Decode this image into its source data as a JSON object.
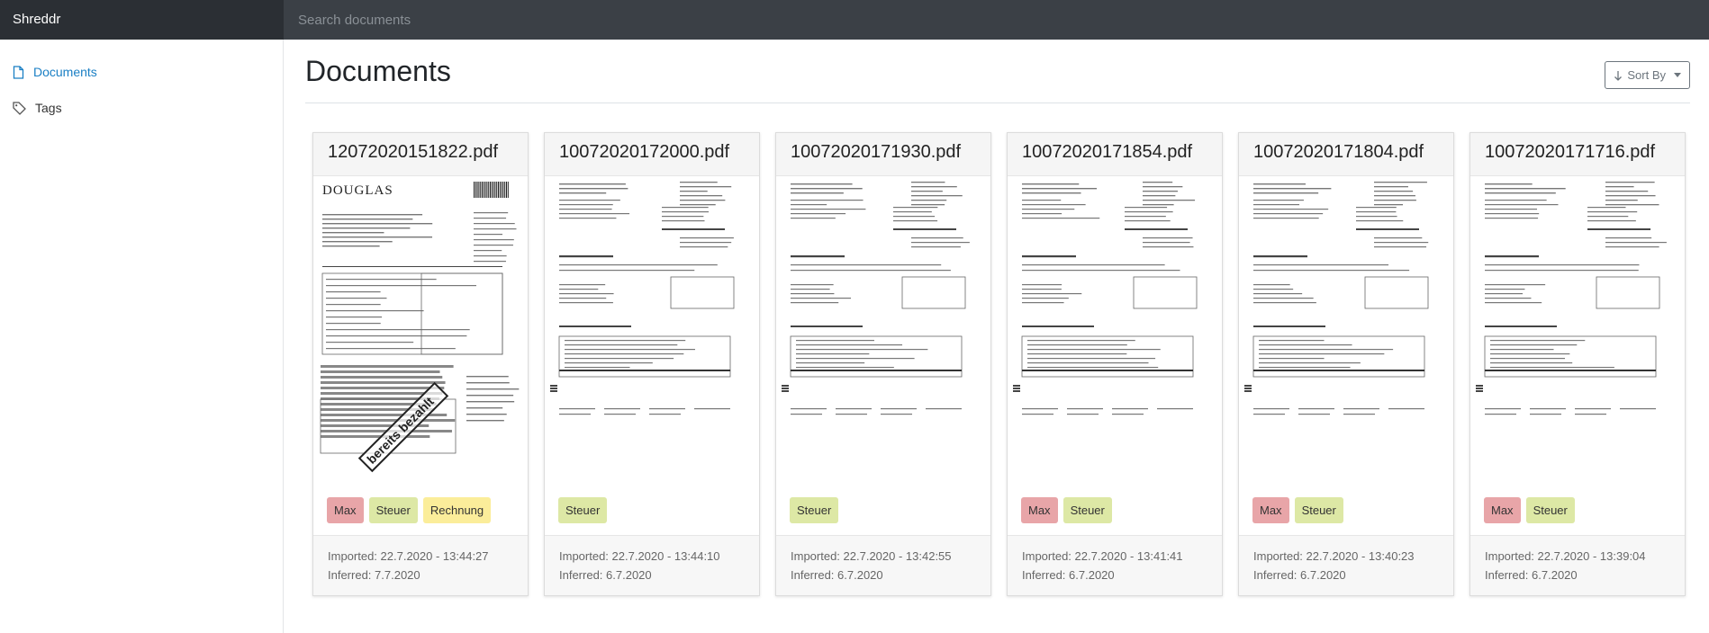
{
  "app": {
    "title": "Shreddr"
  },
  "search": {
    "placeholder": "Search documents"
  },
  "sidebar": {
    "items": [
      {
        "label": "Documents",
        "icon": "file-icon",
        "active": true
      },
      {
        "label": "Tags",
        "icon": "tag-icon",
        "active": false
      }
    ]
  },
  "main": {
    "title": "Documents",
    "sort_label": "Sort By"
  },
  "colors": {
    "max": "#e8a5a8",
    "steuer": "#dde8a5",
    "rechnung": "#fbed9a",
    "accent": "#1a7fc4"
  },
  "documents": [
    {
      "name": "12072020151822.pdf",
      "tags": [
        "Max",
        "Steuer",
        "Rechnung"
      ],
      "imported": "Imported: 22.7.2020 - 13:44:27",
      "inferred": "Inferred: 7.7.2020",
      "thumb_brand": "DOUGLAS",
      "thumb_stamp": "bereits bezahlt"
    },
    {
      "name": "10072020172000.pdf",
      "tags": [
        "Steuer"
      ],
      "imported": "Imported: 22.7.2020 - 13:44:10",
      "inferred": "Inferred: 6.7.2020"
    },
    {
      "name": "10072020171930.pdf",
      "tags": [
        "Steuer"
      ],
      "imported": "Imported: 22.7.2020 - 13:42:55",
      "inferred": "Inferred: 6.7.2020"
    },
    {
      "name": "10072020171854.pdf",
      "tags": [
        "Max",
        "Steuer"
      ],
      "imported": "Imported: 22.7.2020 - 13:41:41",
      "inferred": "Inferred: 6.7.2020"
    },
    {
      "name": "10072020171804.pdf",
      "tags": [
        "Max",
        "Steuer"
      ],
      "imported": "Imported: 22.7.2020 - 13:40:23",
      "inferred": "Inferred: 6.7.2020"
    },
    {
      "name": "10072020171716.pdf",
      "tags": [
        "Max",
        "Steuer"
      ],
      "imported": "Imported: 22.7.2020 - 13:39:04",
      "inferred": "Inferred: 6.7.2020"
    }
  ]
}
